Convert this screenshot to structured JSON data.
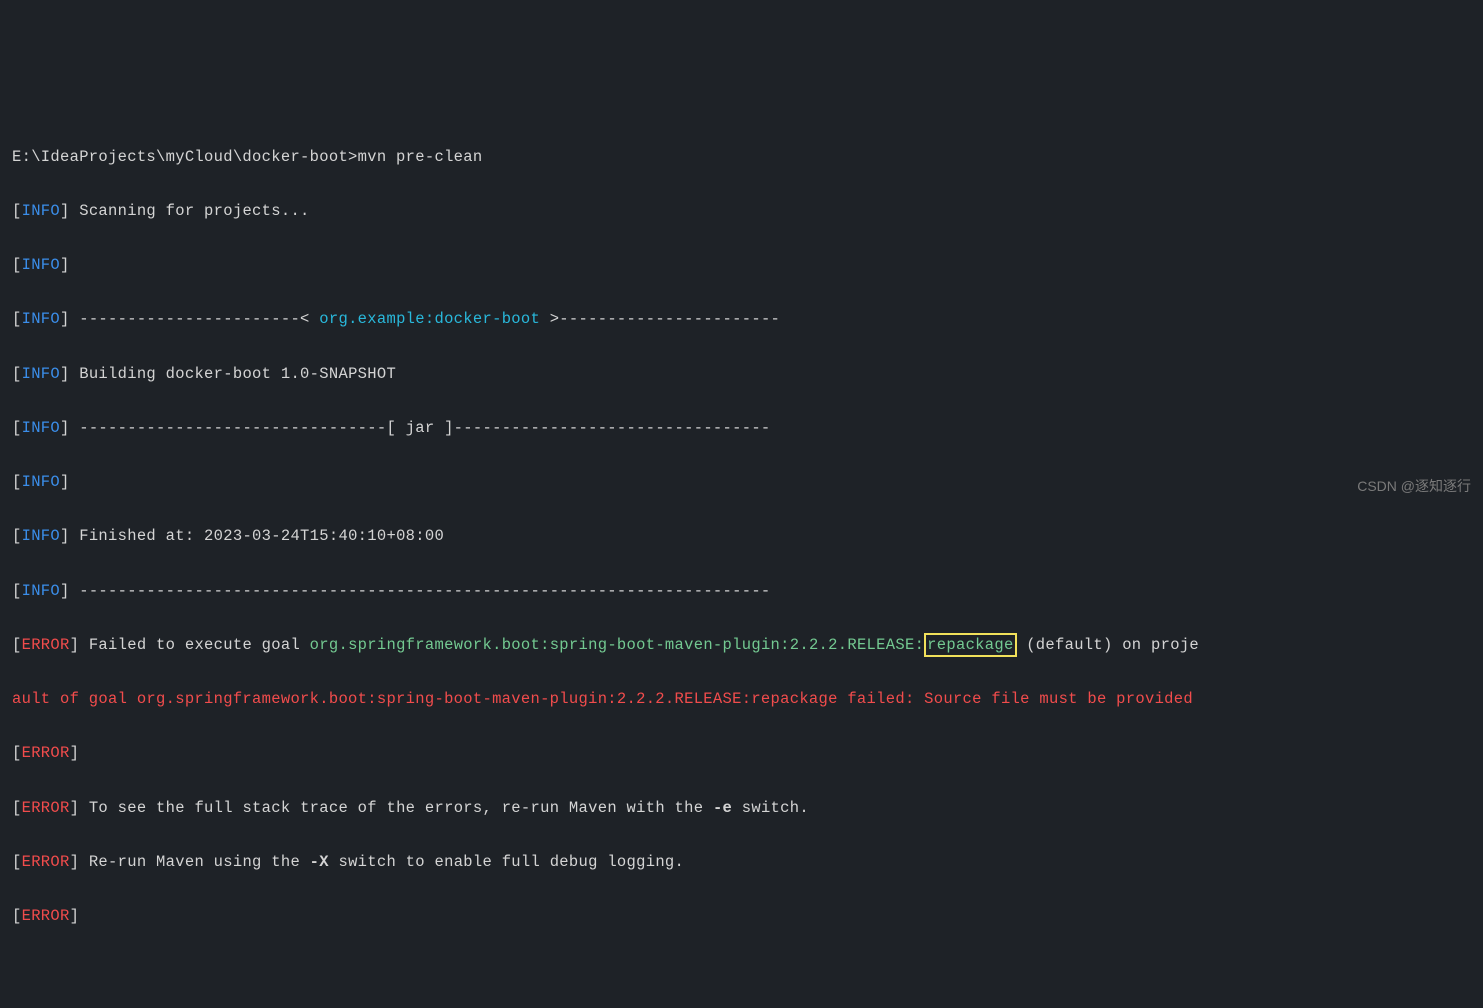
{
  "prompt": "E:\\IdeaProjects\\myCloud\\docker-boot>",
  "command": "mvn pre-clean",
  "info_tag": "INFO",
  "error_tag": "ERROR",
  "scan": " Scanning for projects...",
  "dashes_left": " -----------------------< ",
  "project_coord": "org.example:docker-boot",
  "dashes_right": " >-----------------------",
  "building": " Building docker-boot 1.0-SNAPSHOT",
  "jar_line": " --------------------------------[ jar ]---------------------------------",
  "finished": " Finished at: 2023-03-24T15:40:10+08:00",
  "long_dashes": " ------------------------------------------------------------------------",
  "fail_exec": " Failed to execute goal ",
  "plugin1": "org.springframework.boot:spring-boot-maven-plugin:2.2.2.RELEASE:",
  "repackage": "repackage",
  "default_on": " (default) on proje",
  "err_line2a": "ault of goal org.springframework.boot:spring-boot-maven-plugin:2.2.2.RELEASE:repackage failed: Source file must be provided",
  "stack_trace": " To see the full stack trace of the errors, re-run Maven with the ",
  "e_switch": "-e",
  "switch_suffix": " switch.",
  "rerun": " Re-run Maven using the ",
  "x_switch": "-X",
  "rerun_suffix": " switch to enable full debug logging.",
  "watermark": "CSDN @逐知逐行"
}
